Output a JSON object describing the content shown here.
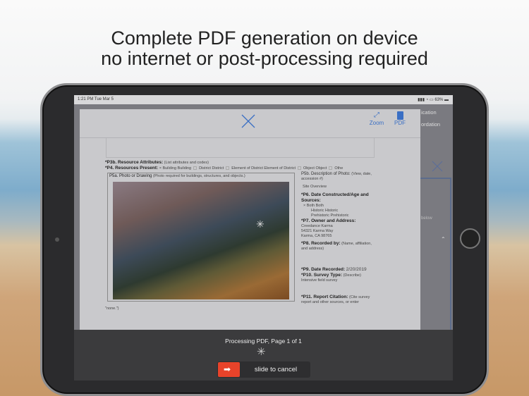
{
  "headline": {
    "line1": "Complete PDF generation on device",
    "line2": "no internet or post-processing required"
  },
  "status_bar": {
    "time": "1:21 PM  Tue Mar 5",
    "battery": "63%"
  },
  "background_app": {
    "item1": "ication",
    "item2": "ordation",
    "hint": "below"
  },
  "sheet": {
    "zoom_label": "Zoom",
    "pdf_label": "PDF"
  },
  "form": {
    "p3b_label": "*P3b.  Resource Attributes:",
    "p3b_hint": "(List attributes and codes)",
    "p4_label": "*P4.  Resources Present:",
    "p4_options": [
      "Building Building",
      "District District",
      "Element of District Element of District",
      "Object Object",
      "Othe"
    ],
    "p5a_label": "P5a.  Photo or Drawing",
    "p5a_hint": "(Photo required for buildings, structures, and objects.)",
    "p5b_label": "P5b.  Description of Photo:",
    "p5b_hint": "(View, date, accession #)",
    "p5b_value": "Site Overview",
    "p6_label": "*P6.  Date Constructed/Age and Sources:",
    "p6_options": [
      "Both Both",
      "Historic Historic",
      "Prehistoric Prehistoric"
    ],
    "p7_label": "*P7.  Owner and Address:",
    "p7_lines": [
      "Creedance Karma",
      "54321 Karma Way",
      "Karma, CA 98765"
    ],
    "p8_label": "*P8.  Recorded by:",
    "p8_hint": "(Name, affiliation, and address)",
    "p9_label": "*P9.  Date Recorded:",
    "p9_value": "2/20/2019",
    "p10_label": "*P10.  Survey Type:",
    "p10_hint": "(Describe)",
    "p10_value": "Intensive field survey",
    "p11_label": "*P11.  Report Citation:",
    "p11_hint": "(Cite survey report and other sources, or enter",
    "p11_tail": "\"none.\")"
  },
  "processing": {
    "status": "Processing PDF, Page 1 of 1",
    "slide_label": "slide to cancel"
  },
  "colors": {
    "accent": "#3a6fc4",
    "cancel": "#e8432a"
  }
}
